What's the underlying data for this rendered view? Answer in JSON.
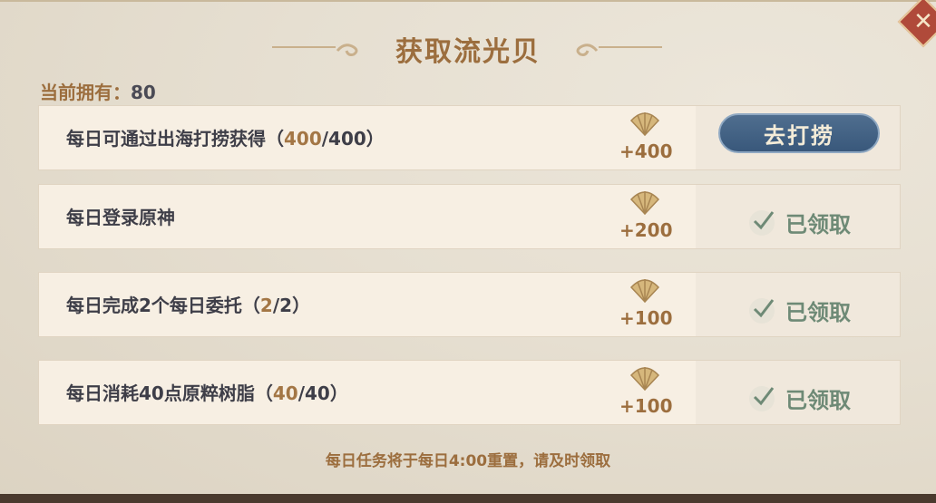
{
  "title": "获取流光贝",
  "owned": {
    "label": "当前拥有：",
    "value": "80"
  },
  "rows": [
    {
      "desc": "每日可通过出海打捞获得（",
      "progress": "400",
      "total": "/400）",
      "reward": "+400",
      "action": "去打捞"
    },
    {
      "desc": "每日登录原神",
      "reward": "+200",
      "action": "已领取"
    },
    {
      "desc": "每日完成2个每日委托（",
      "progress": "2",
      "total": "/2）",
      "reward": "+100",
      "action": "已领取"
    },
    {
      "desc": "每日消耗40点原粹树脂（",
      "progress": "40",
      "total": "/40）",
      "reward": "+100",
      "action": "已领取"
    }
  ],
  "footer": "每日任务将于每日4:00重置，请及时领取",
  "icons": {
    "close": "close-icon",
    "shell": "shell-icon",
    "check": "check-icon"
  },
  "colors": {
    "accent": "#9c6e3e",
    "button": "#3f5e82",
    "claimed": "#6e8a76"
  }
}
